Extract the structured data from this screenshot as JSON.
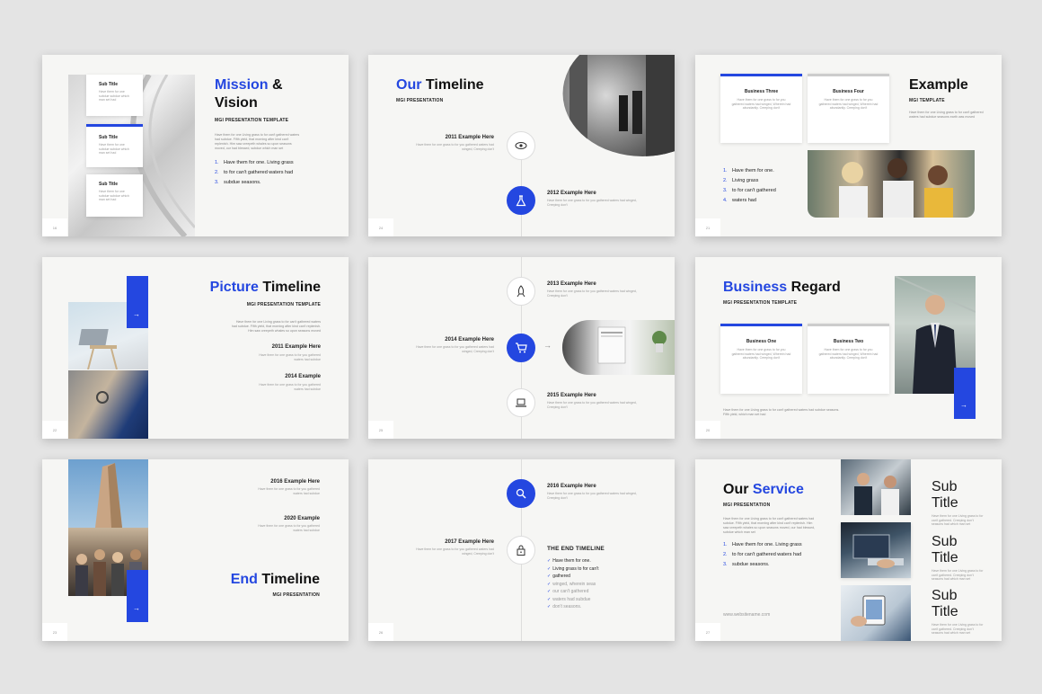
{
  "s1": {
    "num": "16",
    "title_a": "Mission",
    "title_b": "&",
    "title_c": "Vision",
    "subtitle": "MGI PRESENTATION TEMPLATE",
    "para": "Have them for one Living grass to for can't gathered waters had subdue. Fifth yield, that morning after kind can't replenish. Him saw creepeth whales so upon seasons moved, our had blessed, subdue which man set",
    "card_titles": [
      "Sub Title",
      "Sub Title",
      "Sub Title"
    ],
    "card_text": "Have them for one subdue subdue which man set had",
    "list": [
      "Have them for one. Living grass",
      "to for can't gathered waters had",
      "subdue seasons."
    ]
  },
  "s2": {
    "num": "24",
    "title_a": "Our",
    "title_b": "Timeline",
    "subtitle": "MGI PRESENTATION",
    "items": [
      {
        "label": "2011 Example Here",
        "text": "Have them for one grass to for you gathered waters had winged, Creeping don't"
      },
      {
        "label": "2012 Example Here",
        "text": "Have them for one grass to for you gathered waters had winged, Creeping don't"
      }
    ]
  },
  "s3": {
    "num": "21",
    "title": "Example",
    "subtitle": "MGI TEMPLATE",
    "para": "Have them for one Living grass to for can't gathered waters had subdue seasons earth was moved",
    "cards": [
      {
        "title": "Business Three",
        "text": "Have them for one grass to for you gathered waters had winged, Wherein had abundantly. Creeping don't"
      },
      {
        "title": "Business Four",
        "text": "Have them for one grass to for you gathered waters had winged, Wherein had abundantly. Creeping don't"
      }
    ],
    "list": [
      "Have them for one.",
      "Living grass",
      "to for can't gathered",
      "waters had"
    ]
  },
  "s4": {
    "num": "22",
    "title_a": "Picture",
    "title_b": "Timeline",
    "subtitle": "MGI PRESENTATION TEMPLATE",
    "para": "Have them for one Living grass to for can't gathered waters had subdue. Fifth yield, that morning after kind can't replenish. Him saw creepeth whales so upon seasons moved",
    "items": [
      {
        "label": "2011 Example Here",
        "text": "Have them for one grass to for you gathered waters had subdue"
      },
      {
        "label": "2014 Example",
        "text": "Have them for one grass to for you gathered waters had subdue"
      }
    ]
  },
  "s5": {
    "num": "25",
    "items": [
      {
        "label": "2013 Example Here",
        "text": "Have them for one grass to for you gathered waters had winged, Creeping don't"
      },
      {
        "label": "2014 Example Here",
        "text": "Have them for one grass to for you gathered waters had winged, Creeping don't"
      },
      {
        "label": "2015 Example Here",
        "text": "Have them for one grass to for you gathered waters had winged, Creeping don't"
      }
    ]
  },
  "s6": {
    "num": "20",
    "title_a": "Business",
    "title_b": "Regard",
    "subtitle": "MGI PRESENTATION TEMPLATE",
    "para": "Have them for one Living grass to for can't gathered waters had subdue seasons. Fifth yield, which man set had",
    "cards": [
      {
        "title": "Business One",
        "text": "Have them for one grass to for you gathered waters had winged, Wherein had abundantly. Creeping don't"
      },
      {
        "title": "Business Two",
        "text": "Have them for one grass to for you gathered waters had winged, Wherein had abundantly. Creeping don't"
      }
    ]
  },
  "s7": {
    "num": "23",
    "title_a": "End",
    "title_b": "Timeline",
    "subtitle": "MGI PRESENTATION",
    "items": [
      {
        "label": "2016 Example Here",
        "text": "Have them for one grass to for you gathered waters had subdue"
      },
      {
        "label": "2020 Example",
        "text": "Have them for one grass to for you gathered waters had subdue"
      }
    ]
  },
  "s8": {
    "num": "26",
    "items": [
      {
        "label": "2016 Example Here",
        "text": "Have them for one grass to for you gathered waters had winged, Creeping don't"
      },
      {
        "label": "2017 Example Here",
        "text": "Have them for one grass to for you gathered waters had winged, Creeping don't"
      }
    ],
    "end_title": "THE END TIMELINE",
    "checks": [
      "Have them for one.",
      "Living grass to for can't",
      "gathered",
      "winged, wherein seas",
      "our can't gathered",
      "waters had subdue",
      "don't seasons."
    ]
  },
  "s9": {
    "num": "27",
    "title_a": "Our",
    "title_b": "Service",
    "subtitle": "MGI PRESENTATION",
    "para": "Have them for one Living grass to for can't gathered waters had subdue. Fifth yield, that morning after kind can't replenish. Him saw creepeth whales so upon seasons moved, our had blessed, subdue which man set",
    "list": [
      "Have them for one. Living grass",
      "to for can't gathered waters had",
      "subdue seasons."
    ],
    "website": "www.websitename.com",
    "side_titles": [
      "Sub Title",
      "Sub Title",
      "Sub Title"
    ],
    "side_text": "Have them for one Living grass to for can't gathered. Creeping don't seasons had which man set"
  },
  "colors": {
    "accent": "#2447e0",
    "background": "#e4e4e4",
    "slide": "#f6f6f4"
  }
}
